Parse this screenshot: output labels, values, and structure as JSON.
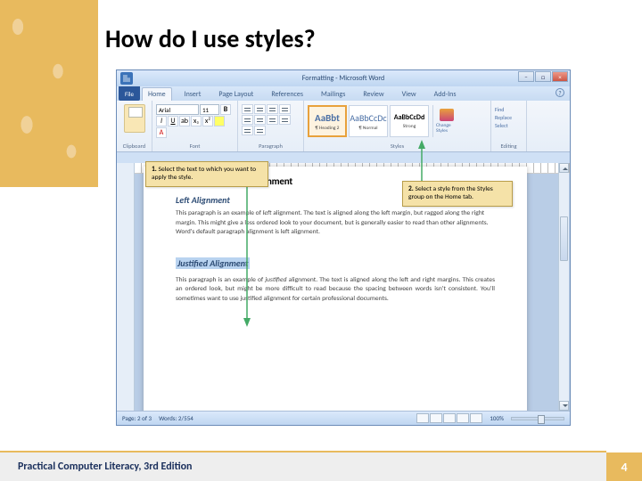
{
  "slide": {
    "title": "How do I use styles?",
    "footer": "Practical Computer Literacy, 3rd Edition",
    "page_number": "4"
  },
  "word": {
    "title": "Formatting - Microsoft Word",
    "file_tab": "File",
    "tabs": [
      "Home",
      "Insert",
      "Page Layout",
      "References",
      "Mailings",
      "Review",
      "View",
      "Add-Ins"
    ],
    "ribbon_groups": {
      "clipboard": "Clipboard",
      "font": "Font",
      "paragraph": "Paragraph",
      "styles": "Styles",
      "editing": "Editing"
    },
    "font_name": "Arial",
    "font_size": "11",
    "styles_gallery": [
      {
        "preview": "AaBbt",
        "label": "¶ Heading 2",
        "selected": true,
        "cls": "h2"
      },
      {
        "preview": "AaBbCcDc",
        "label": "¶ Normal",
        "selected": false,
        "cls": ""
      },
      {
        "preview": "AaBbCcDd",
        "label": "Strong",
        "selected": false,
        "cls": "strong"
      }
    ],
    "change_styles": "Change Styles",
    "editing_items": [
      "Find",
      "Replace",
      "Select"
    ],
    "status": {
      "page": "Page: 2 of 3",
      "words": "Words: 2/554",
      "zoom": "100%"
    }
  },
  "callouts": {
    "c1": "1. Select the text to which you want to apply the style.",
    "c2": "2. Select a style from the Styles group on the Home tab."
  },
  "document": {
    "heading": "Types of Paragraph Alignment",
    "sub1": "Left Alignment",
    "p1a": "This paragraph is an example of ",
    "p1b": "left",
    "p1c": " alignment. The text is aligned along the left margin, but ragged along the right margin. This might give a less ordered look to your document, but is generally easier to read than other alignments. Word's default paragraph alignment is left alignment.",
    "sub2": "Justified Alignment",
    "p2a": "This paragraph is an example of ",
    "p2b": "justified",
    "p2c": " alignment. The text is aligned along the left and right margins. This creates an ordered look, but might be more difficult to read because the spacing between words isn't consistent. You'll sometimes want to use justified alignment for certain professional documents."
  }
}
